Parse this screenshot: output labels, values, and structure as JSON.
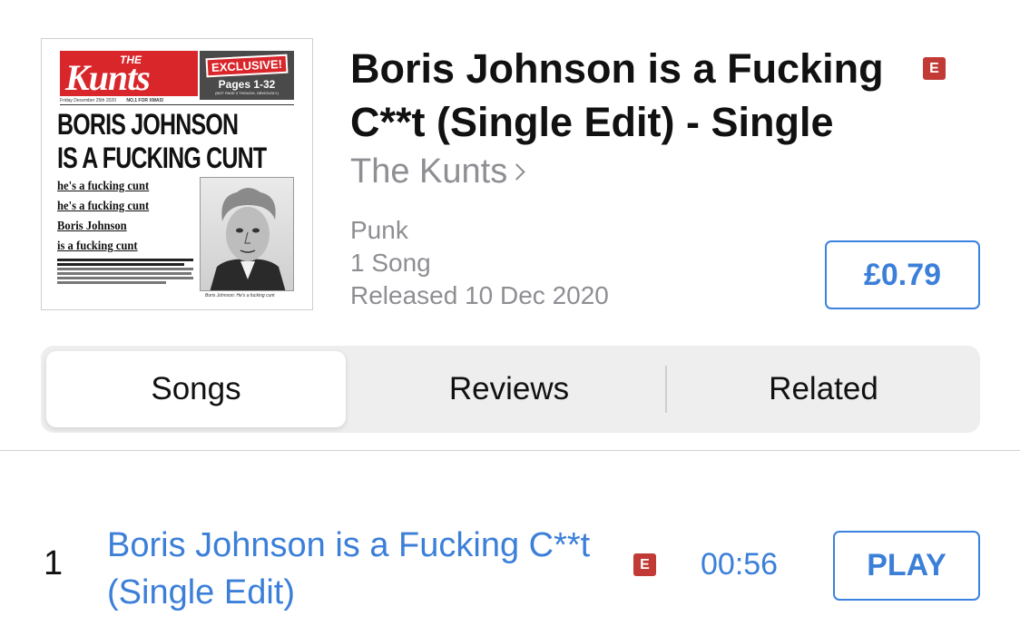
{
  "album": {
    "title": "Boris Johnson is a Fucking C**t (Single Edit) - Single",
    "explicit_badge": "E",
    "artist": "The Kunts",
    "genre": "Punk",
    "song_count": "1 Song",
    "released": "Released 10 Dec 2020",
    "price": "£0.79"
  },
  "cover": {
    "mast_the": "THE",
    "mast_name": "Kunts",
    "exclusive": "EXCLUSIVE!",
    "pages": "Pages 1-32",
    "pages_note": "(NOT PAGE 3 THOUGH, OBVIOUSLY)",
    "date": "Friday December 25th 2020",
    "issue": "NO.1 FOR XMAS!",
    "headline_1": "BORIS JOHNSON",
    "headline_2": "IS A FUCKING CUNT",
    "lyric_1": "he's a fucking cunt",
    "lyric_2": "he's a fucking cunt",
    "lyric_3": "Boris Johnson",
    "lyric_4": "is a fucking cunt",
    "caption": "Boris Johnson: He's a fucking cunt"
  },
  "tabs": {
    "songs": "Songs",
    "reviews": "Reviews",
    "related": "Related",
    "selected": "Songs"
  },
  "tracks": [
    {
      "number": "1",
      "title": "Boris Johnson is a Fucking C**t (Single Edit)",
      "explicit_badge": "E",
      "duration": "00:56",
      "action": "PLAY"
    }
  ],
  "colors": {
    "accent": "#3b7fd9",
    "explicit": "#c13a36",
    "secondary_text": "#8e8e93",
    "segment_bg": "#eeeeef"
  }
}
